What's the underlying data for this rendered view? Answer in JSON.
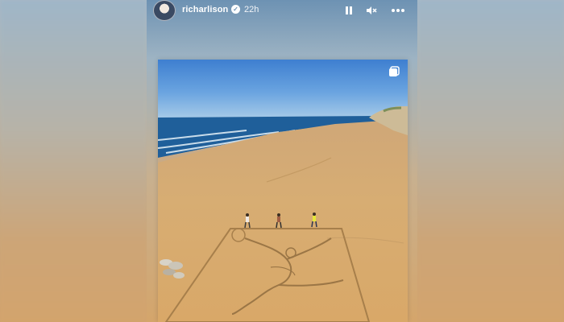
{
  "story": {
    "username": "richarlison",
    "verified": true,
    "time_ago": "22h"
  },
  "controls": {
    "pause_icon": "pause-icon",
    "mute_icon": "speaker-muted-icon",
    "more_icon": "more-horizontal-icon"
  },
  "post": {
    "multi_icon": "carousel-stack-icon"
  },
  "colors": {
    "sky_top": "#3e7fd0",
    "sea": "#1f5f9a",
    "sand": "#d7ad73",
    "text": "#ffffff"
  }
}
